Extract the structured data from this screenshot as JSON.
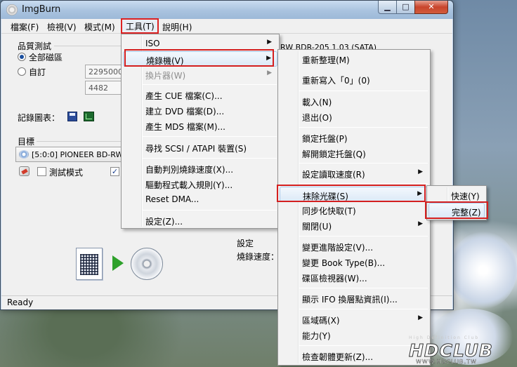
{
  "window": {
    "title": "ImgBurn",
    "status": "Ready"
  },
  "menubar": [
    "檔案(F)",
    "檢視(V)",
    "模式(M)",
    "工具(T)",
    "說明(H)"
  ],
  "left_panel": {
    "group_title": "品質測試",
    "radio_all": "全部磁區",
    "radio_custom": "自訂",
    "field_start": "2295000",
    "field_end": "4482",
    "record_label": "記錄圖表：",
    "target_label": "目標",
    "drive_select": "[5:0:0] PIONEER BD-RW",
    "test_mode": "測試模式",
    "settings_label": "設定",
    "write_speed_label": "燒錄速度："
  },
  "background_drive_text": "RW  BDR-205 1.03 (SATA)",
  "tools_menu": [
    {
      "label": "ISO",
      "submenu": true
    },
    {
      "label": "燒錄機(V)",
      "submenu": true,
      "highlight": true
    },
    {
      "label": "換片器(W)",
      "submenu": true,
      "disabled": true
    },
    {
      "label": "產生 CUE 檔案(C)..."
    },
    {
      "label": "建立 DVD 檔案(D)..."
    },
    {
      "label": "產生 MDS 檔案(M)..."
    },
    {
      "label": "尋找 SCSI / ATAPI 裝置(S)"
    },
    {
      "label": "自動判別燒錄速度(X)..."
    },
    {
      "label": "驅動程式載入規則(Y)..."
    },
    {
      "label": "Reset DMA..."
    },
    {
      "label": "設定(Z)..."
    }
  ],
  "drive_menu": [
    {
      "label": "重新整理(M)"
    },
    {
      "label": "重新寫入「0」(0)"
    },
    {
      "label": "載入(N)"
    },
    {
      "label": "退出(O)"
    },
    {
      "label": "鎖定托盤(P)"
    },
    {
      "label": "解開鎖定托盤(Q)"
    },
    {
      "label": "設定讀取速度(R)",
      "submenu": true
    },
    {
      "label": "抹除光碟(S)",
      "submenu": true,
      "highlight": true
    },
    {
      "label": "同步化快取(T)"
    },
    {
      "label": "關閉(U)",
      "submenu": true
    },
    {
      "label": "變更進階設定(V)..."
    },
    {
      "label": "變更 Book Type(B)..."
    },
    {
      "label": "碟區檢視器(W)..."
    },
    {
      "label": "顯示 IFO 換層點資訊(I)..."
    },
    {
      "label": "區域碼(X)",
      "submenu": true
    },
    {
      "label": "能力(Y)"
    },
    {
      "label": "檢查韌體更新(Z)..."
    }
  ],
  "erase_menu": [
    {
      "label": "快速(Y)"
    },
    {
      "label": "完整(Z)",
      "highlight": true
    }
  ],
  "watermark": {
    "logo": "HDCLUB",
    "subtitle": "High Definition Club",
    "url": "WWW.HDCLUB.TW"
  }
}
